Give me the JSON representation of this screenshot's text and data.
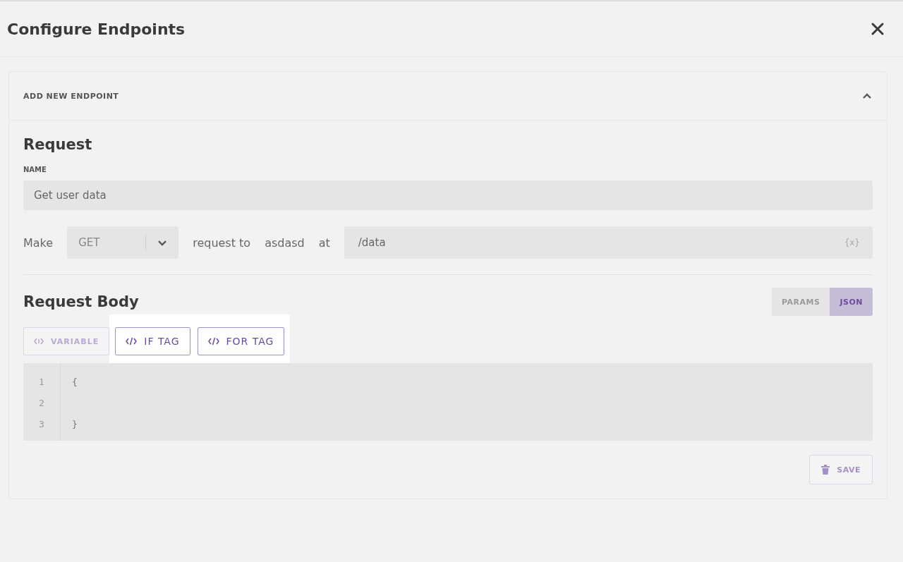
{
  "modal": {
    "title": "Configure Endpoints"
  },
  "section": {
    "title": "ADD NEW ENDPOINT",
    "expanded": true
  },
  "request": {
    "heading": "Request",
    "name_label": "NAME",
    "name_value": "Get user data",
    "make_label": "Make",
    "method": "GET",
    "request_to_label": "request to",
    "service": "asdasd",
    "at_label": "at",
    "path_value": "/data",
    "path_icon": "{x}"
  },
  "body": {
    "heading": "Request Body",
    "modes": [
      {
        "label": "PARAMS",
        "selected": false
      },
      {
        "label": "JSON",
        "selected": true
      }
    ],
    "insert_buttons": [
      {
        "label": "VARIABLE",
        "kind": "variable",
        "highlighted": false
      },
      {
        "label": "IF TAG",
        "kind": "tag",
        "highlighted": true
      },
      {
        "label": "FOR TAG",
        "kind": "tag",
        "highlighted": true
      }
    ],
    "code_lines": [
      {
        "number": "1",
        "text": "{"
      },
      {
        "number": "2"
      },
      {
        "number": "3",
        "text": "}"
      }
    ]
  },
  "save_button": "SAVE"
}
